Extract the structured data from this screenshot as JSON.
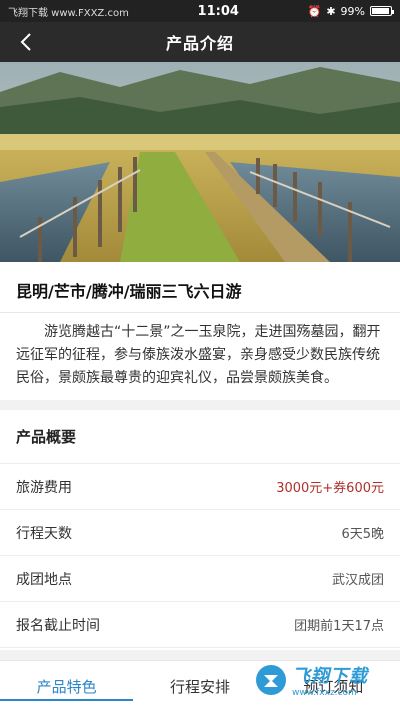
{
  "status": {
    "site_watermark": "飞翔下载 www.FXXZ.com",
    "time": "11:04",
    "battery": "99%"
  },
  "nav": {
    "title": "产品介绍"
  },
  "product": {
    "title": "昆明/芒市/腾冲/瑞丽三飞六日游",
    "description": "游览腾越古“十二景”之一玉泉院，走进国殇墓园，翻开远征军的征程，参与傣族泼水盛宴，亲身感受少数民族传统民俗，景颇族最尊贵的迎宾礼仪，品尝景颇族美食。"
  },
  "overview": {
    "heading": "产品概要",
    "rows": [
      {
        "label": "旅游费用",
        "value": "3000元+券600元"
      },
      {
        "label": "行程天数",
        "value": "6天5晚"
      },
      {
        "label": "成团地点",
        "value": "武汉成团"
      },
      {
        "label": "报名截止时间",
        "value": "团期前1天17点"
      }
    ]
  },
  "tabs": [
    {
      "label": "产品特色",
      "active": true
    },
    {
      "label": "行程安排",
      "active": false
    },
    {
      "label": "预订须知",
      "active": false
    }
  ],
  "watermark": {
    "text": "飞翔下载",
    "sub": "www.fxxz.com"
  },
  "colors": {
    "accent": "#2a86c8",
    "price": "#b0302a",
    "navbar": "#2b2b2b"
  }
}
